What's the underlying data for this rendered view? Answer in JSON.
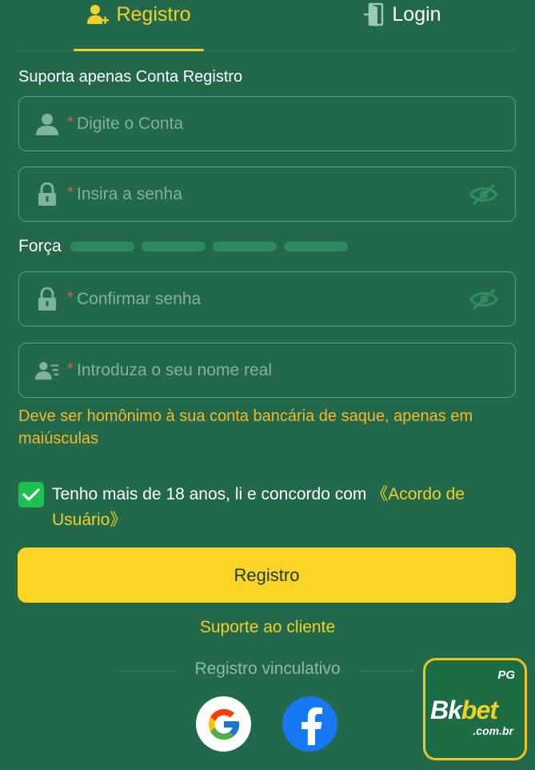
{
  "tabs": {
    "register_label": "Registro",
    "login_label": "Login"
  },
  "form": {
    "subtitle": "Suporta apenas Conta Registro",
    "required_mark": "*",
    "account_placeholder": "Digite o Conta",
    "password_placeholder": "Insira a senha",
    "strength_label": "Força",
    "confirm_placeholder": "Confirmar senha",
    "realname_placeholder": "Introduza o seu nome real",
    "realname_hint": "Deve ser homônimo à sua conta bancária de saque, apenas em maiúsculas"
  },
  "agreement": {
    "checked": true,
    "text": "Tenho mais de 18 anos, li e concordo com ",
    "link": "《Acordo de Usuário》"
  },
  "actions": {
    "register_button": "Registro",
    "support_link": "Suporte ao cliente"
  },
  "social": {
    "label": "Registro vinculativo",
    "providers": [
      "google-icon",
      "facebook-icon"
    ]
  },
  "logo": {
    "badge": "PG",
    "brand_part1": "Bk",
    "brand_part2": "bet",
    "domain": ".com.br"
  },
  "colors": {
    "background": "#22684a",
    "accent": "#f5cf26",
    "button": "#fad526",
    "hint": "#f5b82a",
    "required": "#e05a4a",
    "checkbox": "#1fc052"
  }
}
